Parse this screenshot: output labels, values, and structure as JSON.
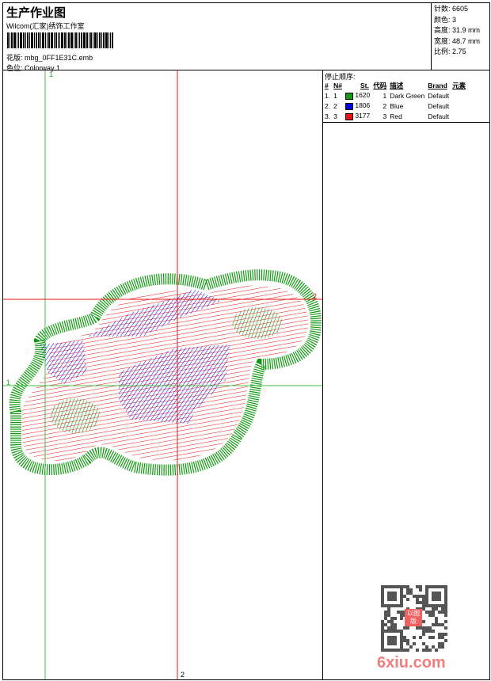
{
  "header": {
    "title": "生产作业图",
    "company": "Wilcom(汇家)绣饰工作室",
    "file_label": "花版:",
    "file": "mbg_0FF1E31C.emb",
    "color_label": "色位:",
    "colorway": "Colorway 1"
  },
  "info": {
    "stitches_label": "针数:",
    "stitches": "6605",
    "colors_label": "颜色:",
    "colors": "3",
    "height_label": "高度:",
    "height": "31.9 mm",
    "width_label": "宽度:",
    "width": "48.7 mm",
    "scale_label": "比例:",
    "scale": "2.75"
  },
  "stop_sequence": {
    "caption": "停止顺序:",
    "columns": [
      "#",
      "N#",
      "St.",
      "代码",
      "描述",
      "Brand",
      "元素"
    ],
    "rows": [
      {
        "idx": "1.",
        "n": "1",
        "color": "#119911",
        "st": "1620",
        "code": "1",
        "desc": "Dark Green",
        "brand": "Default"
      },
      {
        "idx": "2.",
        "n": "2",
        "color": "#0000ee",
        "st": "1806",
        "code": "2",
        "desc": "Blue",
        "brand": "Default"
      },
      {
        "idx": "3.",
        "n": "3",
        "color": "#ee1111",
        "st": "3177",
        "code": "3",
        "desc": "Red",
        "brand": "Default"
      }
    ]
  },
  "markers": {
    "top": "1",
    "bottom": "2",
    "right": "2",
    "left": "1"
  },
  "watermark": "6xiu.com",
  "stamp": "以图版"
}
